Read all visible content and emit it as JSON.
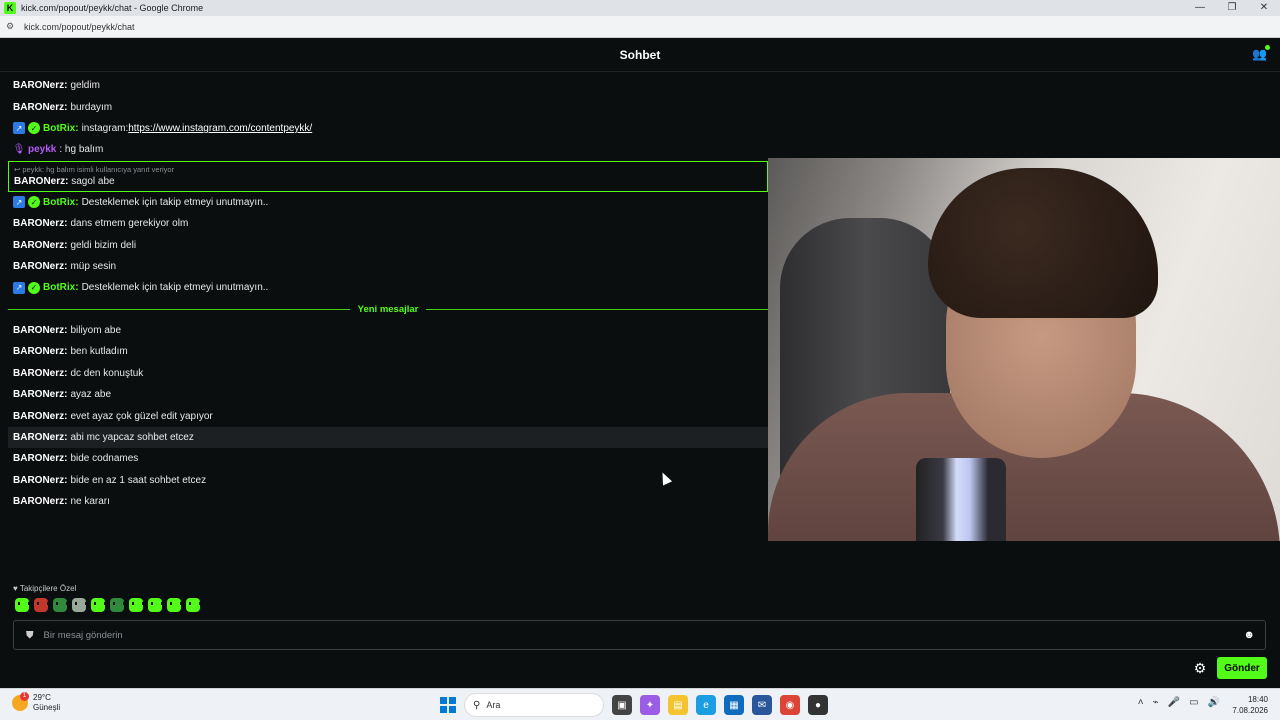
{
  "window": {
    "title": "kick.com/popout/peykk/chat - Google Chrome",
    "url": "kick.com/popout/peykk/chat",
    "controls": [
      "—",
      "❐",
      "✕"
    ]
  },
  "chat": {
    "title": "Sohbet",
    "messages": [
      {
        "user": "BARONerz:",
        "text": "geldim"
      },
      {
        "user": "BARONerz:",
        "text": "burdayım"
      },
      {
        "user": "BotRix:",
        "text": "instagram: ",
        "link": "https://www.instagram.com/contentpeykk/"
      },
      {
        "user": "peykk",
        "text": ": hg balım"
      },
      {
        "reply_ref": "peykk: hg balım isimli kullanıcıya yanıt veriyor",
        "user": "BARONerz:",
        "text": "sagol abe"
      },
      {
        "user": "BotRix:",
        "text": "Desteklemek için takip etmeyi unutmayın.."
      },
      {
        "user": "BARONerz:",
        "text": "dans etmem gerekiyor olm"
      },
      {
        "user": "BARONerz:",
        "text": "geldi bizim deli"
      },
      {
        "user": "BARONerz:",
        "text": "müp sesin"
      },
      {
        "user": "BotRix:",
        "text": "Desteklemek için takip etmeyi unutmayın.."
      },
      {
        "user": "BARONerz:",
        "text": "biliyom abe"
      },
      {
        "user": "BARONerz:",
        "text": "ben kutladım"
      },
      {
        "user": "BARONerz:",
        "text": "dc den konuştuk"
      },
      {
        "user": "BARONerz:",
        "text": "ayaz abe"
      },
      {
        "user": "BARONerz:",
        "text": "evet ayaz çok güzel edit yapıyor"
      },
      {
        "user": "BARONerz:",
        "text": "abi mc yapcaz sohbet etcez"
      },
      {
        "user": "BARONerz:",
        "text": "bide codnames"
      },
      {
        "user": "BARONerz:",
        "text": "bide en az 1 saat sohbet etcez"
      },
      {
        "user": "BARONerz:",
        "text": "ne kararı"
      }
    ],
    "new_messages_label": "Yeni mesajlar",
    "followers_label": "Takipçilere Özel",
    "input_placeholder": "Bir mesaj gönderin",
    "send_label": "Gönder"
  },
  "taskbar": {
    "temperature": "29°C",
    "weather": "Güneşli",
    "weather_badge": "1",
    "search": "Ara",
    "time": "18:40",
    "date": "7.08.2026"
  },
  "colors": {
    "accent": "#53fc18",
    "bot": "#53fc18",
    "host": "#b45cf6"
  }
}
